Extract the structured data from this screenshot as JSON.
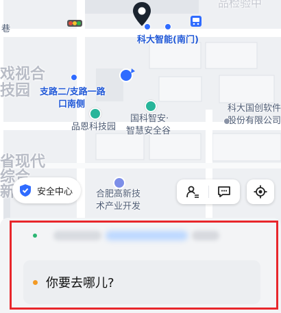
{
  "map": {
    "labels": {
      "top_right_partial": "品检验中",
      "left_partial_1": "巷",
      "left_partial_2": "戏视合",
      "left_partial_3": "技园",
      "left_partial_4": "省现代",
      "left_partial_5": "综合",
      "left_partial_6": "新",
      "destination_label": "科大智能(南门)",
      "branch_road_line1": "支路二/支路一路",
      "branch_road_line2": "口南侧",
      "pinen_park": "品恩科技园",
      "guoke_line1": "国科智安·",
      "guoke_line2": "智慧安全谷",
      "keda_guochuang_line1": "科大国创软件",
      "keda_guochuang_line2": "股份有限公司",
      "hefei_line1": "合肥高新技",
      "hefei_line2": "术产业开发"
    },
    "accent_blue": "#2f6bff",
    "poi_green": "#28b59a"
  },
  "safety_center": {
    "label": "安全中心",
    "icon": "shield-icon"
  },
  "controls": {
    "route_icon": "person-route-icon",
    "message_icon": "message-icon",
    "locate_icon": "locate-icon"
  },
  "panel": {
    "destination_prompt": "你要去哪儿?",
    "start_dot_color": "#2bb673",
    "dest_dot_color": "#f39a24"
  }
}
